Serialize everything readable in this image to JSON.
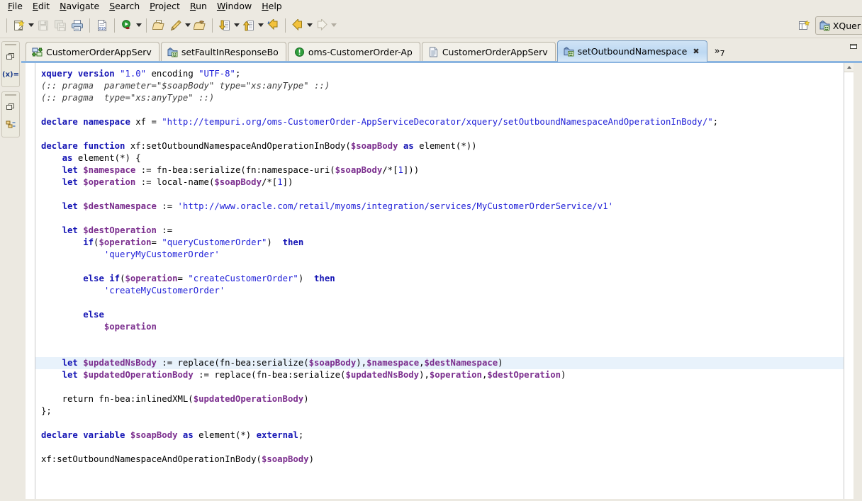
{
  "menubar": {
    "items": [
      {
        "label": "File",
        "mnemonic": "F"
      },
      {
        "label": "Edit",
        "mnemonic": "E"
      },
      {
        "label": "Navigate",
        "mnemonic": "N"
      },
      {
        "label": "Search",
        "mnemonic": "S"
      },
      {
        "label": "Project",
        "mnemonic": "P"
      },
      {
        "label": "Run",
        "mnemonic": "R"
      },
      {
        "label": "Window",
        "mnemonic": "W"
      },
      {
        "label": "Help",
        "mnemonic": "H"
      }
    ]
  },
  "toolbar": {
    "buttons": [
      {
        "name": "new-wizard-button",
        "icon": "new-file-icon",
        "enabled": true,
        "dropdown": true
      },
      {
        "name": "save-button",
        "icon": "save-icon",
        "enabled": false,
        "dropdown": false
      },
      {
        "name": "save-all-button",
        "icon": "save-all-icon",
        "enabled": false,
        "dropdown": false
      },
      {
        "name": "print-button",
        "icon": "print-icon",
        "enabled": true,
        "dropdown": false
      },
      {
        "name": "binary-view-button",
        "icon": "binary-file-icon",
        "enabled": true,
        "dropdown": false
      },
      {
        "name": "run-button",
        "icon": "run-icon",
        "enabled": true,
        "dropdown": true
      },
      {
        "name": "open-resource-button",
        "icon": "open-folder-icon",
        "enabled": true,
        "dropdown": false
      },
      {
        "name": "search-button",
        "icon": "pencil-search-icon",
        "enabled": true,
        "dropdown": true
      },
      {
        "name": "open-type-button",
        "icon": "package-icon",
        "enabled": true,
        "dropdown": false
      },
      {
        "name": "next-annotation-button",
        "icon": "down-arrow-doc-icon",
        "enabled": true,
        "dropdown": true
      },
      {
        "name": "previous-annotation-button",
        "icon": "up-arrow-doc-icon",
        "enabled": true,
        "dropdown": true
      },
      {
        "name": "last-edit-location-button",
        "icon": "last-edit-arrow-icon",
        "enabled": true,
        "dropdown": false
      },
      {
        "name": "back-button",
        "icon": "back-arrow-icon",
        "enabled": true,
        "dropdown": true
      },
      {
        "name": "forward-button",
        "icon": "forward-arrow-icon",
        "enabled": false,
        "dropdown": true
      }
    ]
  },
  "perspective_bar": {
    "open_perspective_name": "open-perspective-icon",
    "active_perspective": "XQuer"
  },
  "left_rail": {
    "groups": [
      {
        "name": "fast-view-group-variables",
        "icons": [
          {
            "name": "restore-view-icon",
            "kind": "restore"
          },
          {
            "name": "variables-view-icon",
            "kind": "text",
            "text": "(x)="
          }
        ]
      },
      {
        "name": "fast-view-group-outline",
        "icons": [
          {
            "name": "restore-view-icon",
            "kind": "restore"
          },
          {
            "name": "outline-view-icon",
            "kind": "outline"
          }
        ]
      }
    ]
  },
  "editor_tabs": {
    "tabs": [
      {
        "label": "CustomerOrderAppServ",
        "icon": "xml-transform-icon",
        "active": false,
        "closable": false
      },
      {
        "label": "setFaultInResponseBo",
        "icon": "xquery-icon",
        "active": false,
        "closable": false
      },
      {
        "label": "oms-CustomerOrder-Ap",
        "icon": "error-icon",
        "active": false,
        "closable": false
      },
      {
        "label": "CustomerOrderAppServ",
        "icon": "document-icon",
        "active": false,
        "closable": false
      },
      {
        "label": "setOutboundNamespace",
        "icon": "xquery-icon",
        "active": true,
        "closable": true,
        "close_glyph": "✖"
      }
    ],
    "overflow": {
      "chevron": "»",
      "count": "7"
    },
    "maximize_name": "maximize-editor-button"
  },
  "editor": {
    "language": "XQuery",
    "highlighted_line_index": 24,
    "lines": [
      [
        [
          "kw",
          "xquery version"
        ],
        [
          "pln",
          " "
        ],
        [
          "str",
          "\"1.0\""
        ],
        [
          "pln",
          " encoding "
        ],
        [
          "str",
          "\"UTF-8\""
        ],
        [
          "pln",
          ";"
        ]
      ],
      [
        [
          "cmt",
          "(:: pragma  parameter=\"$soapBody\" type=\"xs:anyType\" ::)"
        ]
      ],
      [
        [
          "cmt",
          "(:: pragma  type=\"xs:anyType\" ::)"
        ]
      ],
      [],
      [
        [
          "kw",
          "declare namespace"
        ],
        [
          "pln",
          " xf = "
        ],
        [
          "str",
          "\"http://tempuri.org/oms-CustomerOrder-AppServiceDecorator/xquery/setOutboundNamespaceAndOperationInBody/\""
        ],
        [
          "pln",
          ";"
        ]
      ],
      [],
      [
        [
          "kw",
          "declare function"
        ],
        [
          "pln",
          " xf:setOutboundNamespaceAndOperationInBody("
        ],
        [
          "var",
          "$soapBody"
        ],
        [
          "pln",
          " "
        ],
        [
          "kw",
          "as"
        ],
        [
          "pln",
          " element(*))"
        ]
      ],
      [
        [
          "pln",
          "    "
        ],
        [
          "kw",
          "as"
        ],
        [
          "pln",
          " element(*) {"
        ]
      ],
      [
        [
          "pln",
          "    "
        ],
        [
          "kw",
          "let"
        ],
        [
          "pln",
          " "
        ],
        [
          "var",
          "$namespace"
        ],
        [
          "pln",
          " := fn-bea:serialize(fn:namespace-uri("
        ],
        [
          "var",
          "$soapBody"
        ],
        [
          "pln",
          "/*["
        ],
        [
          "num",
          "1"
        ],
        [
          "pln",
          "]))"
        ]
      ],
      [
        [
          "pln",
          "    "
        ],
        [
          "kw",
          "let"
        ],
        [
          "pln",
          " "
        ],
        [
          "var",
          "$operation"
        ],
        [
          "pln",
          " := local-name("
        ],
        [
          "var",
          "$soapBody"
        ],
        [
          "pln",
          "/*["
        ],
        [
          "num",
          "1"
        ],
        [
          "pln",
          "])"
        ]
      ],
      [],
      [
        [
          "pln",
          "    "
        ],
        [
          "kw",
          "let"
        ],
        [
          "pln",
          " "
        ],
        [
          "var",
          "$destNamespace"
        ],
        [
          "pln",
          " := "
        ],
        [
          "str",
          "'http://www.oracle.com/retail/myoms/integration/services/MyCustomerOrderService/v1'"
        ]
      ],
      [],
      [
        [
          "pln",
          "    "
        ],
        [
          "kw",
          "let"
        ],
        [
          "pln",
          " "
        ],
        [
          "var",
          "$destOperation"
        ],
        [
          "pln",
          " :="
        ]
      ],
      [
        [
          "pln",
          "        "
        ],
        [
          "kw",
          "if"
        ],
        [
          "pln",
          "("
        ],
        [
          "var",
          "$operation"
        ],
        [
          "pln",
          "= "
        ],
        [
          "str",
          "\"queryCustomerOrder\""
        ],
        [
          "pln",
          ")  "
        ],
        [
          "kw",
          "then"
        ]
      ],
      [
        [
          "pln",
          "            "
        ],
        [
          "str",
          "'queryMyCustomerOrder'"
        ]
      ],
      [],
      [
        [
          "pln",
          "        "
        ],
        [
          "kw",
          "else if"
        ],
        [
          "pln",
          "("
        ],
        [
          "var",
          "$operation"
        ],
        [
          "pln",
          "= "
        ],
        [
          "str",
          "\"createCustomerOrder\""
        ],
        [
          "pln",
          ")  "
        ],
        [
          "kw",
          "then"
        ]
      ],
      [
        [
          "pln",
          "            "
        ],
        [
          "str",
          "'createMyCustomerOrder'"
        ]
      ],
      [],
      [
        [
          "pln",
          "        "
        ],
        [
          "kw",
          "else"
        ]
      ],
      [
        [
          "pln",
          "            "
        ],
        [
          "var",
          "$operation"
        ]
      ],
      [],
      [],
      [
        [
          "pln",
          "    "
        ],
        [
          "kw",
          "let"
        ],
        [
          "pln",
          " "
        ],
        [
          "var",
          "$updatedNsBody"
        ],
        [
          "pln",
          " := replace(fn-bea:serialize("
        ],
        [
          "var",
          "$soapBody"
        ],
        [
          "pln",
          "),"
        ],
        [
          "var",
          "$namespace"
        ],
        [
          "pln",
          ","
        ],
        [
          "var",
          "$destNamespace"
        ],
        [
          "pln",
          ")"
        ]
      ],
      [
        [
          "pln",
          "    "
        ],
        [
          "kw",
          "let"
        ],
        [
          "pln",
          " "
        ],
        [
          "var",
          "$updatedOperationBody"
        ],
        [
          "pln",
          " := replace(fn-bea:serialize("
        ],
        [
          "var",
          "$updatedNsBody"
        ],
        [
          "pln",
          "),"
        ],
        [
          "var",
          "$operation"
        ],
        [
          "pln",
          ","
        ],
        [
          "var",
          "$destOperation"
        ],
        [
          "pln",
          ")"
        ]
      ],
      [],
      [
        [
          "pln",
          "    return fn-bea:inlinedXML("
        ],
        [
          "var",
          "$updatedOperationBody"
        ],
        [
          "pln",
          ")"
        ]
      ],
      [
        [
          "pln",
          "};"
        ]
      ],
      [],
      [
        [
          "kw",
          "declare variable"
        ],
        [
          "pln",
          " "
        ],
        [
          "var",
          "$soapBody"
        ],
        [
          "pln",
          " "
        ],
        [
          "kw",
          "as"
        ],
        [
          "pln",
          " element(*) "
        ],
        [
          "kw",
          "external"
        ],
        [
          "pln",
          ";"
        ]
      ],
      [],
      [
        [
          "pln",
          "xf:setOutboundNamespaceAndOperationInBody("
        ],
        [
          "var",
          "$soapBody"
        ],
        [
          "pln",
          ")"
        ]
      ]
    ]
  },
  "colors": {
    "chrome": "#ece9e1",
    "keyword": "#1414b4",
    "string": "#2020d8",
    "comment": "#3f3f3f",
    "variable": "#7b2e8e",
    "active_tab_start": "#cfe3f5",
    "active_tab_end": "#d8e9f8",
    "current_line_highlight": "#e8f2fb",
    "editor_top_border": "#8ab4e0"
  }
}
